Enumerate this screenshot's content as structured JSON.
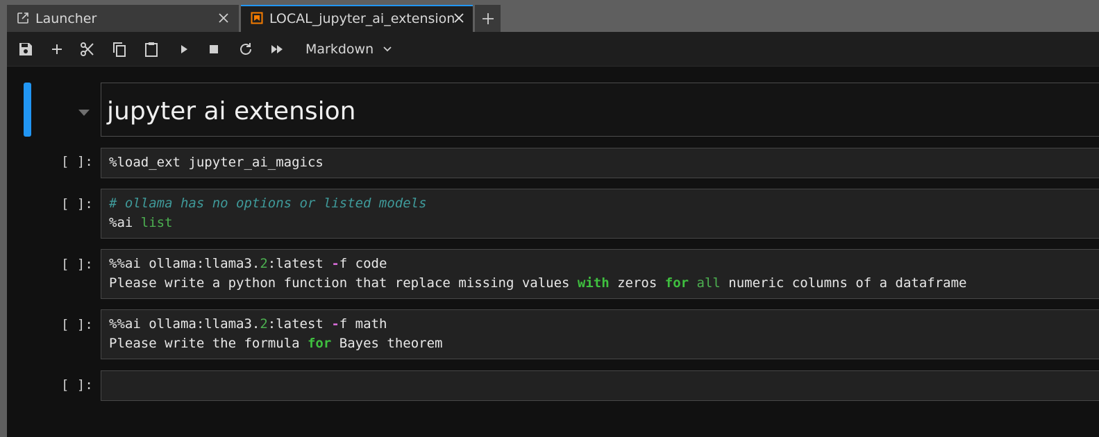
{
  "tabs": [
    {
      "label": "Launcher",
      "icon": "launch-icon",
      "active": false
    },
    {
      "label": "LOCAL_jupyter_ai_extension",
      "icon": "notebook-icon",
      "active": true
    }
  ],
  "toolbar": {
    "buttons": [
      "save-icon",
      "add-icon",
      "cut-icon",
      "copy-icon",
      "paste-icon",
      "run-icon",
      "stop-icon",
      "restart-icon",
      "run-all-icon"
    ],
    "cell_type": "Markdown"
  },
  "cells": {
    "markdown": {
      "heading": "jupyter ai extension"
    },
    "prompt": "[ ]:",
    "c1": {
      "l1": {
        "a": "%load_ext jupyter_ai_magics"
      }
    },
    "c2": {
      "l1": {
        "comment": "# ollama has no options or listed models"
      },
      "l2": {
        "a": "%ai ",
        "b": "list"
      }
    },
    "c3": {
      "l1": {
        "a": "%%ai ollama:llama3.",
        "num": "2",
        "b": ":latest ",
        "flag": "-",
        "c": "f code"
      },
      "l2": {
        "a": "Please write a python function that replace missing values ",
        "kw1": "with",
        "b": " zeros ",
        "kw2": "for",
        "c": " ",
        "kw3": "all",
        "d": " numeric columns of a dataframe"
      }
    },
    "c4": {
      "l1": {
        "a": "%%ai ollama:llama3.",
        "num": "2",
        "b": ":latest ",
        "flag": "-",
        "c": "f math"
      },
      "l2": {
        "a": "Please write the formula ",
        "kw": "for",
        "b": " Bayes theorem"
      }
    },
    "c5": {
      "l1": {
        "a": ""
      }
    }
  },
  "colors": {
    "accent": "#2196f3",
    "comment": "#3f9a9a",
    "keyword": "#3fbf3f",
    "operator": "#d36ad3"
  }
}
